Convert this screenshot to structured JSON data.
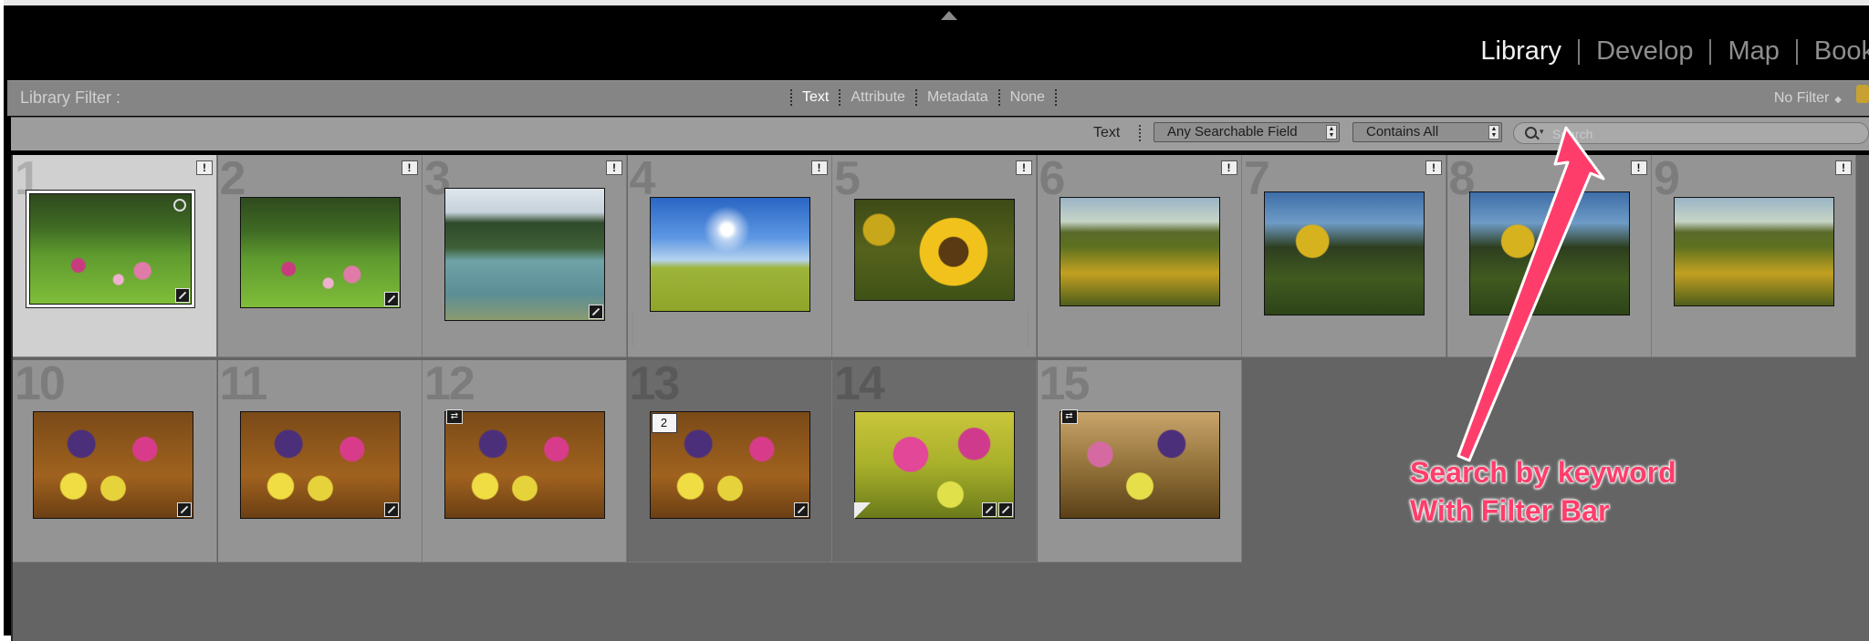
{
  "modules": [
    {
      "label": "Library",
      "active": true
    },
    {
      "label": "Develop",
      "active": false
    },
    {
      "label": "Map",
      "active": false
    },
    {
      "label": "Book",
      "active": false
    }
  ],
  "filter_bar": {
    "label": "Library Filter :",
    "tabs": [
      "Text",
      "Attribute",
      "Metadata",
      "None"
    ],
    "active_tab": "Text",
    "preset": "No Filter"
  },
  "text_filter": {
    "label": "Text",
    "field": "Any Searchable Field",
    "rule": "Contains All",
    "search_placeholder": "Search",
    "search_value": ""
  },
  "grid": {
    "cells": [
      {
        "num": "1",
        "kind": "garden"
      },
      {
        "num": "2",
        "kind": "garden"
      },
      {
        "num": "3",
        "kind": "river"
      },
      {
        "num": "4",
        "kind": "sunfield"
      },
      {
        "num": "5",
        "kind": "sunflower"
      },
      {
        "num": "6",
        "kind": "field"
      },
      {
        "num": "7",
        "kind": "closeup"
      },
      {
        "num": "8",
        "kind": "closeup"
      },
      {
        "num": "9",
        "kind": "field"
      },
      {
        "num": "10",
        "kind": "bouquet"
      },
      {
        "num": "11",
        "kind": "bouquet"
      },
      {
        "num": "12",
        "kind": "bouquet"
      },
      {
        "num": "13",
        "kind": "bouquet"
      },
      {
        "num": "14",
        "kind": "pinkbouquet"
      },
      {
        "num": "15",
        "kind": "bouquet2"
      }
    ],
    "stack_count": "2",
    "flag_symbol": "!",
    "sync_symbol": "⇄"
  },
  "annotation": {
    "line1": "Search by keyword",
    "line2": "With Filter Bar",
    "color": "#ff3d6b"
  },
  "colors": {
    "panel_bg": "#000000",
    "filter_bar": "#858585",
    "grid_bg": "#646464",
    "cell_bg": "#949494",
    "cell_selected": "#d0d0d0"
  }
}
